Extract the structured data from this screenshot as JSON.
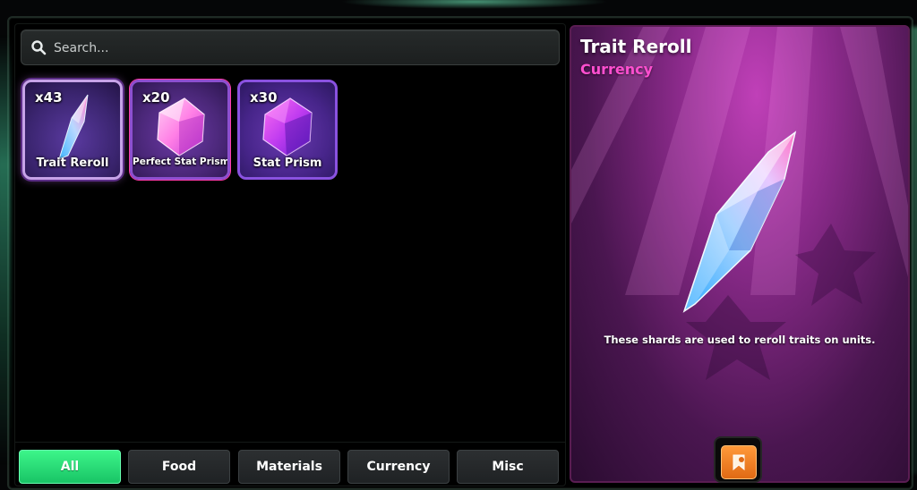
{
  "search": {
    "placeholder": "Search..."
  },
  "inventory": {
    "items": [
      {
        "name": "Trait Reroll",
        "quantity": "x43",
        "selected": true,
        "icon": "crystal-shard-icon"
      },
      {
        "name": "Perfect Stat Prism",
        "quantity": "x20",
        "selected": false,
        "icon": "pink-prism-icon"
      },
      {
        "name": "Stat Prism",
        "quantity": "x30",
        "selected": false,
        "icon": "purple-prism-icon"
      }
    ]
  },
  "tabs": [
    {
      "label": "All",
      "active": true
    },
    {
      "label": "Food",
      "active": false
    },
    {
      "label": "Materials",
      "active": false
    },
    {
      "label": "Currency",
      "active": false
    },
    {
      "label": "Misc",
      "active": false
    }
  ],
  "detail": {
    "title": "Trait Reroll",
    "category": "Currency",
    "description": "These shards are used to reroll traits on units.",
    "action_icon": "bookmark-icon"
  },
  "colors": {
    "active_tab": "#2ee27a",
    "category_text": "#ff4fd0",
    "detail_bg": "#8a2a8a"
  }
}
